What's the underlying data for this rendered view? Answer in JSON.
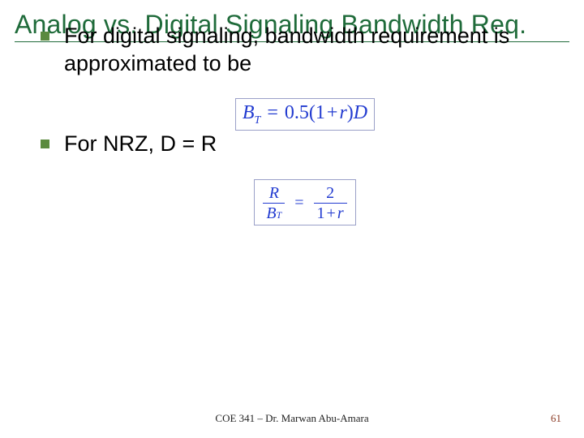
{
  "title": "Analog vs. Digital Signaling Bandwidth Req.",
  "bullets": [
    "For digital signaling, bandwidth requirement is approximated to be",
    "For NRZ, D = R"
  ],
  "formula1": {
    "lhs_var": "B",
    "lhs_sub": "T",
    "rhs_prefix": "0.5(1",
    "rhs_op": "+",
    "rhs_mid": "r",
    "rhs_close": ")",
    "rhs_tail": "D"
  },
  "formula2": {
    "left_num": "R",
    "left_den_var": "B",
    "left_den_sub": "T",
    "right_num": "2",
    "right_den_prefix": "1",
    "right_den_op": "+",
    "right_den_tail": "r"
  },
  "footer": "COE 341 – Dr. Marwan Abu-Amara",
  "page": "61"
}
